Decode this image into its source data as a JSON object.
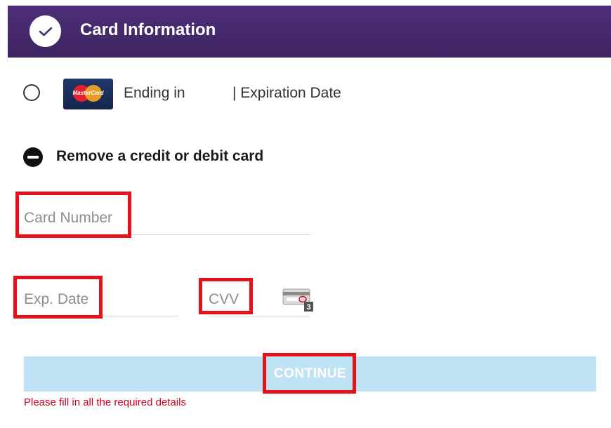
{
  "header": {
    "title": "Card Information",
    "check_icon": "check-icon",
    "background_color": "#3f2463"
  },
  "saved_card": {
    "brand_label": "MasterCard",
    "ending_label": "Ending in",
    "expiration_label": "| Expiration Date"
  },
  "remove_card": {
    "label": "Remove a credit or debit card",
    "icon": "minus-circle-icon"
  },
  "form": {
    "card_number_placeholder": "Card Number",
    "exp_date_placeholder": "Exp. Date",
    "cvv_placeholder": "CVV",
    "cvv_icon": "card-cvv-icon",
    "cvv_icon_digit": "3"
  },
  "continue_button": {
    "label": "CONTINUE",
    "color": "#bee3f4"
  },
  "error": {
    "message": "Please fill in all the required details",
    "color": "#d0021b"
  },
  "highlight_color": "#e5121b"
}
